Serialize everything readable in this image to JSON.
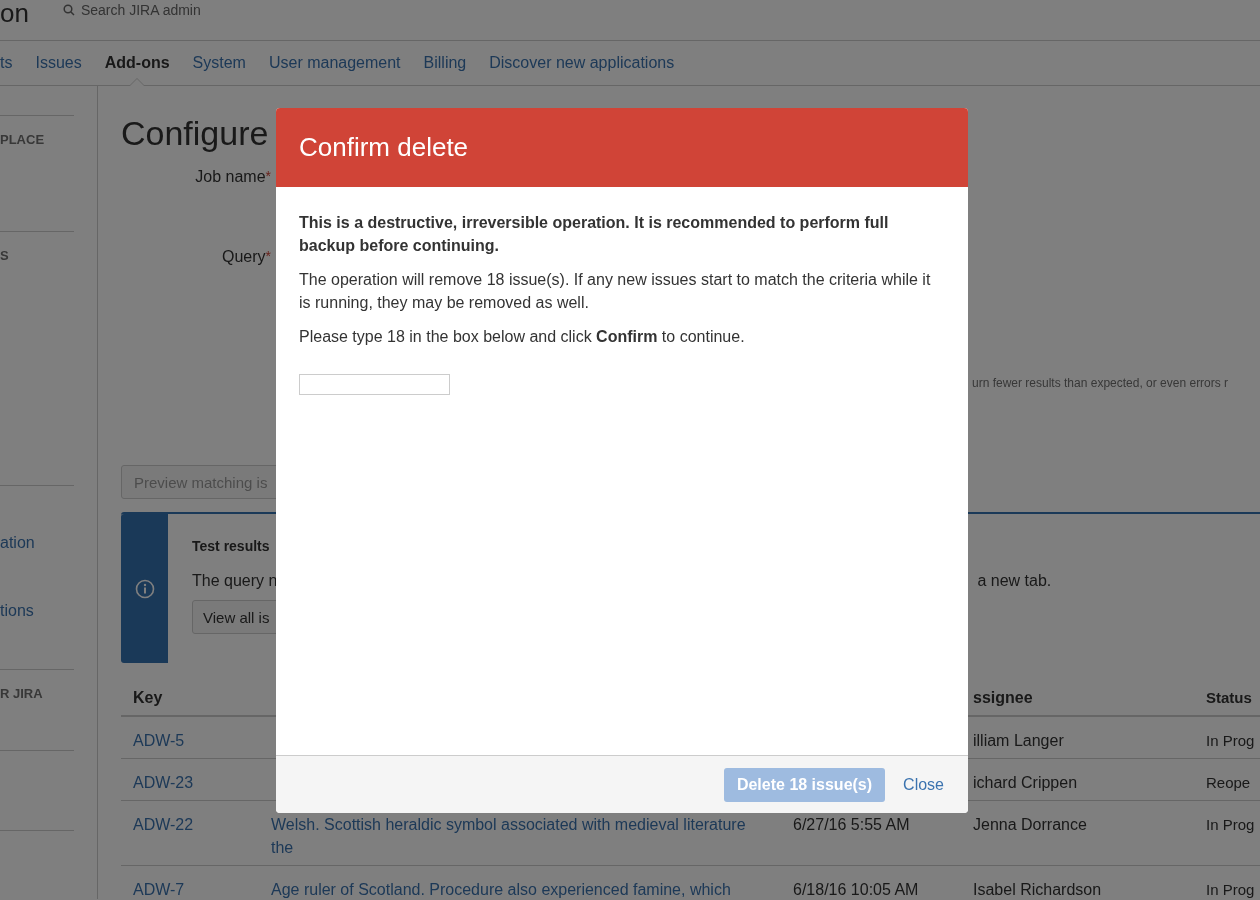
{
  "header": {
    "logo_text": "on",
    "search_placeholder": "Search JIRA admin"
  },
  "nav": [
    {
      "label": "ts",
      "selected": false
    },
    {
      "label": "Issues",
      "selected": false
    },
    {
      "label": "Add-ons",
      "selected": true
    },
    {
      "label": "System",
      "selected": false
    },
    {
      "label": "User management",
      "selected": false
    },
    {
      "label": "Billing",
      "selected": false
    },
    {
      "label": "Discover new applications",
      "selected": false
    }
  ],
  "sidebar": {
    "sections": [
      {
        "kind": "heading",
        "label": "PLACE"
      },
      {
        "kind": "heading",
        "label": "S"
      },
      {
        "kind": "links",
        "links": [
          "ation",
          "tions"
        ]
      },
      {
        "kind": "heading",
        "label": "R JIRA"
      },
      {
        "kind": "blank"
      }
    ]
  },
  "form": {
    "title": "Configure",
    "fields": [
      {
        "label": "Job name",
        "required_mark": "*"
      },
      {
        "label": "Query",
        "required_mark": "*"
      }
    ],
    "hint": "urn fewer results than expected, or even errors r",
    "preview_button": "Preview matching is",
    "info": {
      "title": "Test results",
      "text": "The query n",
      "text_right": "a new tab.",
      "button": "View all is"
    }
  },
  "table": {
    "columns": [
      {
        "label": "Key"
      },
      {},
      {},
      {
        "label": "ssignee"
      },
      {
        "label": "Status"
      }
    ],
    "rows": [
      {
        "key": "ADW-5",
        "assignee": "illiam Langer",
        "status": "In Prog"
      },
      {
        "key": "ADW-23",
        "assignee": "ichard Crippen",
        "status": "Reope"
      },
      {
        "key": "ADW-22",
        "summary": "Welsh. Scottish heraldic symbol associated with medieval literature the",
        "created": "6/27/16 5:55 AM",
        "assignee": "Jenna Dorrance",
        "status": "In Prog"
      },
      {
        "key": "ADW-7",
        "summary": "Age ruler of Scotland. Procedure also experienced famine, which",
        "created": "6/18/16 10:05 AM",
        "assignee": "Isabel Richardson",
        "status": "In Prog"
      }
    ]
  },
  "dialog": {
    "title": "Confirm delete",
    "warning": "This is a destructive, irreversible operation. It is recommended to perform full backup before continuing.",
    "message": "The operation will remove 18 issue(s). If any new issues start to match the criteria while it is running, they may be removed as well.",
    "instruction": "Please type 18 in the box below and click **Confirm** to continue.",
    "confirm_button": {
      "label": "Delete 18 issue(s)",
      "disabled": true
    },
    "close_link": "Close"
  }
}
